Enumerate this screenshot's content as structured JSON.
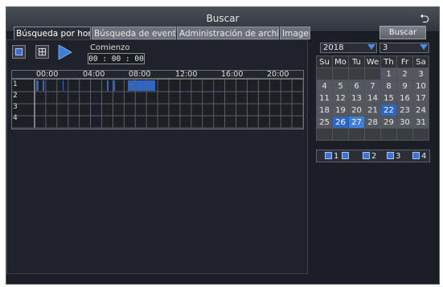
{
  "window": {
    "title": "Buscar",
    "back_icon": "return-arrow-icon"
  },
  "tabs": [
    {
      "label": "Búsqueda por hora",
      "active": true
    },
    {
      "label": "Búsqueda de eventos",
      "active": false
    },
    {
      "label": "Administración de archivos",
      "active": false
    },
    {
      "label": "Imagen",
      "active": false
    }
  ],
  "search_button": "Buscar",
  "controls": {
    "icons": [
      "single-view-icon",
      "quad-view-icon",
      "play-icon"
    ]
  },
  "start": {
    "label": "Comienzo",
    "value": "00 : 00 : 00"
  },
  "timeline": {
    "hour_labels": [
      "00:00",
      "04:00",
      "08:00",
      "12:00",
      "16:00",
      "20:00"
    ],
    "channels": [
      "1",
      "2",
      "3",
      "4"
    ],
    "recording_color": "#2e66c6"
  },
  "calendar": {
    "year": "2018",
    "month": "3",
    "weekdays": [
      "Su",
      "Mo",
      "Tu",
      "We",
      "Th",
      "Fr",
      "Sa"
    ],
    "weeks": [
      [
        "",
        "",
        "",
        "",
        "1",
        "2",
        "3"
      ],
      [
        "4",
        "5",
        "6",
        "7",
        "8",
        "9",
        "10"
      ],
      [
        "11",
        "12",
        "13",
        "14",
        "15",
        "16",
        "17"
      ],
      [
        "18",
        "19",
        "20",
        "21",
        "22",
        "23",
        "24"
      ],
      [
        "25",
        "26",
        "27",
        "28",
        "29",
        "30",
        "31"
      ],
      [
        "",
        "",
        "",
        "",
        "",
        "",
        ""
      ]
    ],
    "highlighted_days": [
      "22",
      "26",
      "27"
    ],
    "selected_day": "27",
    "highlight_color": "#2f67c4"
  },
  "channel_checks": [
    {
      "label": "1",
      "checked": true
    },
    {
      "label": "2",
      "checked": true
    },
    {
      "label": "3",
      "checked": true
    },
    {
      "label": "4",
      "checked": true
    }
  ]
}
